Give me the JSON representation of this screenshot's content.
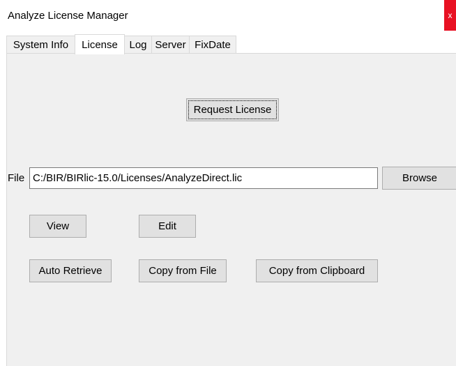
{
  "window": {
    "title": "Analyze License Manager",
    "close_glyph": "x"
  },
  "tabs": [
    {
      "label": "System Info",
      "active": false
    },
    {
      "label": "License",
      "active": true
    },
    {
      "label": "Log",
      "active": false
    },
    {
      "label": "Server",
      "active": false
    },
    {
      "label": "FixDate",
      "active": false
    }
  ],
  "license": {
    "request_button": "Request License",
    "file_label": "File",
    "file_path": "C:/BIR/BIRlic-15.0/Licenses/AnalyzeDirect.lic",
    "browse_button": "Browse",
    "view_button": "View",
    "edit_button": "Edit",
    "auto_retrieve_button": "Auto Retrieve",
    "copy_from_file_button": "Copy from File",
    "copy_from_clipboard_button": "Copy from Clipboard"
  },
  "colors": {
    "close_button": "#e81123",
    "panel_background": "#f0f0f0",
    "button_face": "#e1e1e1"
  }
}
